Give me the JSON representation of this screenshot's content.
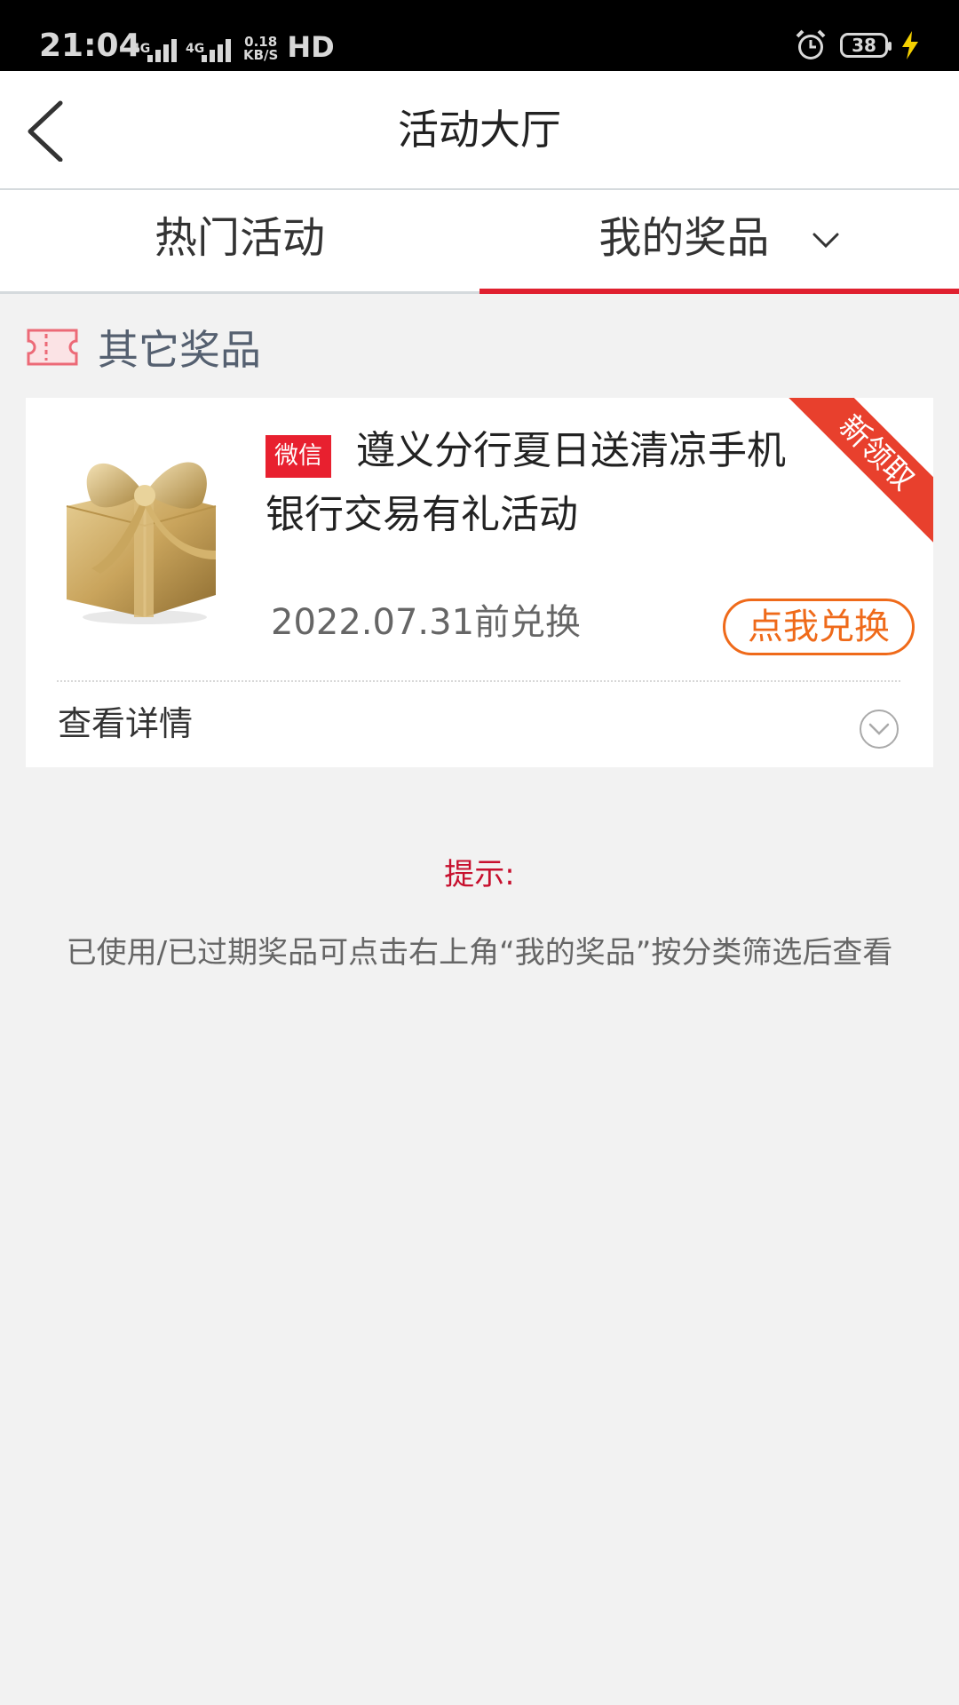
{
  "status_bar": {
    "time": "21:04",
    "net1": "4G",
    "net2": "4G",
    "speed_value": "0.18",
    "speed_unit": "KB/S",
    "hd": "HD",
    "battery": "38",
    "icons": [
      "alarm-icon",
      "battery-icon",
      "charging-icon"
    ]
  },
  "header": {
    "title": "活动大厅",
    "back_icon": "back-arrow-icon"
  },
  "tabs": {
    "items": [
      {
        "label": "热门活动",
        "active": false
      },
      {
        "label": "我的奖品",
        "active": true
      }
    ],
    "accent_color": "#e0202f"
  },
  "section": {
    "title": "其它奖品",
    "icon": "ticket-icon"
  },
  "prize": {
    "tag": "微信",
    "name": "遵义分行夏日送清凉手机银行交易有礼活动",
    "ribbon": "新领取",
    "date": "2022.07.31前兑换",
    "redeem_label": "点我兑换",
    "detail_label": "查看详情",
    "image": "gift-box-icon"
  },
  "hint": {
    "title": "提示:",
    "text": "已使用/已过期奖品可点击右上角“我的奖品”按分类筛选后查看"
  }
}
